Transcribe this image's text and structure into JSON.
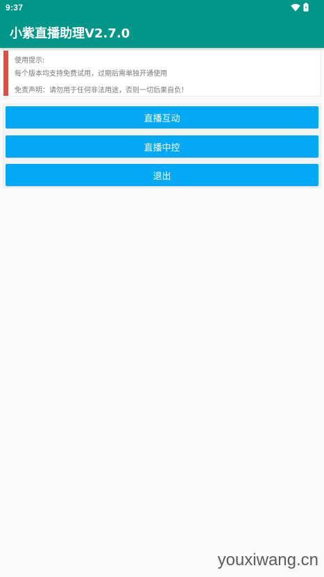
{
  "status_bar": {
    "time": "9:37",
    "icons": [
      "wifi-icon",
      "battery-icon"
    ]
  },
  "app_bar": {
    "title": "小紫直播助理V2.7.0",
    "color": "#009688"
  },
  "notice": {
    "accent_color": "#e74c3c",
    "heading": "使用提示:",
    "line1": "每个版本均支持免费试用，过期后需单独开通使用",
    "line2": "免责声明：请勿用于任何非法用途，否则一切后果自负！"
  },
  "buttons": {
    "color": "#03a9f4",
    "live_interaction": "直播互动",
    "live_control": "直播中控",
    "exit": "退出"
  },
  "watermark": "youxiwang.cn"
}
